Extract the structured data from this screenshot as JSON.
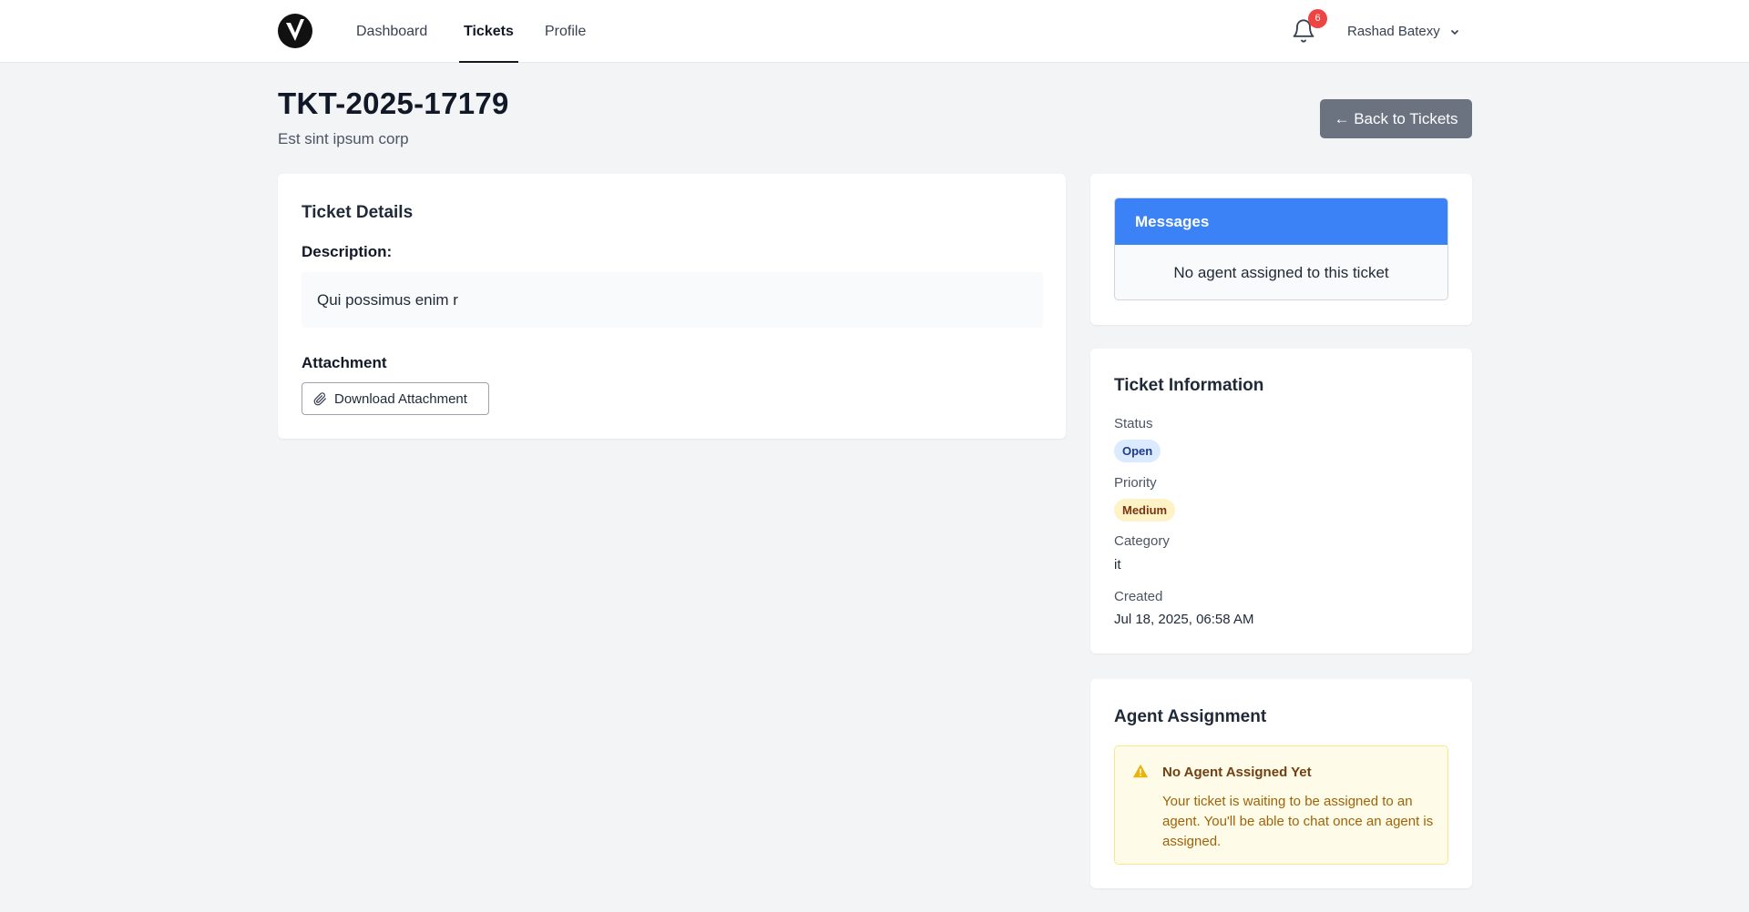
{
  "nav": {
    "links": [
      {
        "label": "Dashboard",
        "active": false
      },
      {
        "label": "Tickets",
        "active": true
      },
      {
        "label": "Profile",
        "active": false
      }
    ],
    "notification_count": "6",
    "user_name": "Rashad Batexy"
  },
  "header": {
    "title": "TKT-2025-17179",
    "subtitle": "Est sint ipsum corp",
    "back_label": "← Back to Tickets"
  },
  "details": {
    "title": "Ticket Details",
    "description_label": "Description:",
    "description": "Qui possimus enim r",
    "attachment_label": "Attachment",
    "download_label": "Download Attachment"
  },
  "messages": {
    "title": "Messages",
    "empty_text": "No agent assigned to this ticket"
  },
  "info": {
    "title": "Ticket Information",
    "status_label": "Status",
    "status": "Open",
    "priority_label": "Priority",
    "priority": "Medium",
    "category_label": "Category",
    "category": "it",
    "created_label": "Created",
    "created": "Jul 18, 2025, 06:58 AM"
  },
  "agent": {
    "title": "Agent Assignment",
    "warning_title": "No Agent Assigned Yet",
    "warning_text": "Your ticket is waiting to be assigned to an agent. You'll be able to chat once an agent is assigned."
  },
  "colors": {
    "accent": "#3b82f6",
    "badge_red": "#ef4444",
    "warning": "#eab308"
  },
  "icons": [
    "logo-icon",
    "bell-icon",
    "chevron-down-icon",
    "paperclip-icon",
    "warning-icon"
  ]
}
